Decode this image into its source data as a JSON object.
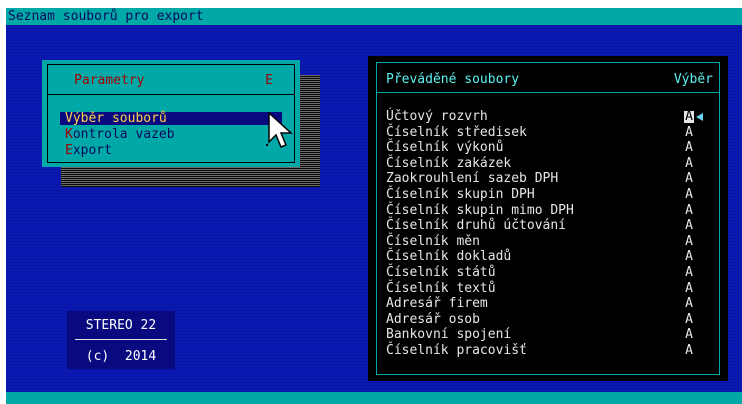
{
  "title_bar": {
    "text": "Seznam souborů pro export"
  },
  "menu": {
    "title": "Parametry",
    "title_key": "E",
    "items": [
      {
        "hotkey": "V",
        "rest": "ýběr souborů",
        "selected": true
      },
      {
        "hotkey": "K",
        "rest": "ontrola vazeb",
        "selected": false
      },
      {
        "hotkey": "E",
        "rest": "xport",
        "selected": false
      }
    ]
  },
  "logo": {
    "name": "STEREO 22",
    "copyright": "(c)  2014"
  },
  "files_panel": {
    "title": "Převáděné soubory",
    "column_label": "Výběr",
    "rows": [
      {
        "name": "Účtový rozvrh",
        "value": "A"
      },
      {
        "name": "Číselník středisek",
        "value": "A"
      },
      {
        "name": "Číselník výkonů",
        "value": "A"
      },
      {
        "name": "Číselník zakázek",
        "value": "A"
      },
      {
        "name": "Zaokrouhlení sazeb DPH",
        "value": "A"
      },
      {
        "name": "Číselník skupin DPH",
        "value": "A"
      },
      {
        "name": "Číselník skupin mimo DPH",
        "value": "A"
      },
      {
        "name": "Číselník druhů účtování",
        "value": "A"
      },
      {
        "name": "Číselník měn",
        "value": "A"
      },
      {
        "name": "Číselník dokladů",
        "value": "A"
      },
      {
        "name": "Číselník států",
        "value": "A"
      },
      {
        "name": "Číselník textů",
        "value": "A"
      },
      {
        "name": "Adresář firem",
        "value": "A"
      },
      {
        "name": "Adresář osob",
        "value": "A"
      },
      {
        "name": "Bankovní spojení",
        "value": "A"
      },
      {
        "name": "Číselník pracovišť",
        "value": "A"
      }
    ]
  },
  "colors": {
    "background": "#0a19b4",
    "bar": "#00a8a8",
    "menu_bg": "#00a8a8",
    "hotkey": "#a00000",
    "selected_bg": "#0a0a80",
    "selected_fg": "#ffd24a",
    "panel_bg": "#000000",
    "panel_accent": "#5cf2f2"
  }
}
